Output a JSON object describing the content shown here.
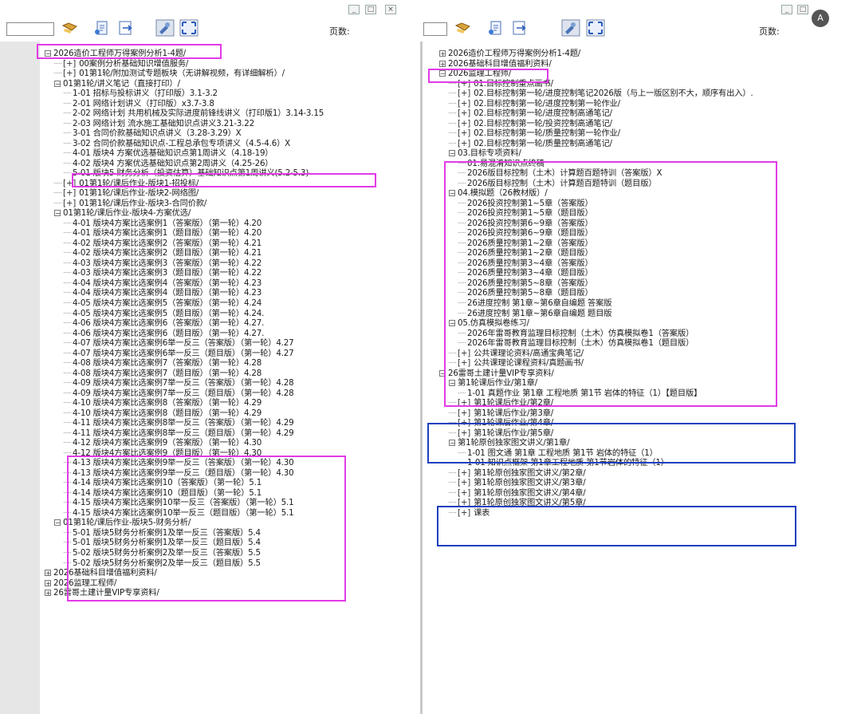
{
  "left_pane": {
    "pages_label": "页数:",
    "window_buttons": [
      "_",
      "□",
      "×"
    ],
    "rows": [
      {
        "indent": 0,
        "toggle": "⊟",
        "text": "2026造价工程师万得案例分析1-4题/"
      },
      {
        "indent": 1,
        "toggle": "",
        "prefix": "[+]",
        "text": "00案例分析基础知识增值服务/"
      },
      {
        "indent": 1,
        "toggle": "",
        "prefix": "[+]",
        "text": "01第1轮/附加测试专题板块（无讲解视频，有详细解析）/"
      },
      {
        "indent": 1,
        "toggle": "⊟",
        "text": "01第1轮/讲义笔记（直接打印）/"
      },
      {
        "indent": 2,
        "toggle": "",
        "text": "1-01 招标与投标讲义（打印版）3.1-3.2"
      },
      {
        "indent": 2,
        "toggle": "",
        "text": "2-01 网络计划讲义（打印版）x3.7-3.8"
      },
      {
        "indent": 2,
        "toggle": "",
        "text": "2-02 网络计划 共用机械及实际进度前锋线讲义（打印版1）3.14-3.15"
      },
      {
        "indent": 2,
        "toggle": "",
        "text": "2-03 网络计划 流水施工基础知识点讲义3.21-3.22"
      },
      {
        "indent": 2,
        "toggle": "",
        "text": "3-01 合同价款基础知识点讲义（3.28-3.29）X"
      },
      {
        "indent": 2,
        "toggle": "",
        "text": "3-02 合同价款基础知识点-工程总承包专项讲义（4.5-4.6）X"
      },
      {
        "indent": 2,
        "toggle": "",
        "text": "4-01 版块4 方案优选基础知识点第1周讲义（4.18-19）"
      },
      {
        "indent": 2,
        "toggle": "",
        "text": "4-02 版块4 方案优选基础知识点第2周讲义（4.25-26）"
      },
      {
        "indent": 2,
        "toggle": "",
        "text": "5-01 版块5 财务分析（投资估算）基础知识点第1周讲义(5.2-5.3)"
      },
      {
        "indent": 1,
        "toggle": "",
        "prefix": "[+]",
        "text": "01第1轮/课后作业-版块1-招投标/"
      },
      {
        "indent": 1,
        "toggle": "",
        "prefix": "[+]",
        "text": "01第1轮/课后作业-版块2-网络图/"
      },
      {
        "indent": 1,
        "toggle": "",
        "prefix": "[+]",
        "text": "01第1轮/课后作业-版块3-合同价款/"
      },
      {
        "indent": 1,
        "toggle": "⊟",
        "text": "01第1轮/课后作业-版块4-方案优选/"
      },
      {
        "indent": 2,
        "toggle": "",
        "text": "4-01 版块4方案比选案例1（答案版）（第一轮）4.20"
      },
      {
        "indent": 2,
        "toggle": "",
        "text": "4-01 版块4方案比选案例1（题目版）（第一轮）4.20"
      },
      {
        "indent": 2,
        "toggle": "",
        "text": "4-02 版块4方案比选案例2（答案版）（第一轮）4.21"
      },
      {
        "indent": 2,
        "toggle": "",
        "text": "4-02 版块4方案比选案例2（题目版）（第一轮）4.21"
      },
      {
        "indent": 2,
        "toggle": "",
        "text": "4-03 版块4方案比选案例3（答案版）（第一轮）4.22"
      },
      {
        "indent": 2,
        "toggle": "",
        "text": "4-03 版块4方案比选案例3（题目版）（第一轮）4.22"
      },
      {
        "indent": 2,
        "toggle": "",
        "text": "4-04 版块4方案比选案例4（答案版）（第一轮）4.23"
      },
      {
        "indent": 2,
        "toggle": "",
        "text": "4-04 版块4方案比选案例4（题目版）（第一轮）4.23"
      },
      {
        "indent": 2,
        "toggle": "",
        "text": "4-05 版块4方案比选案例5（答案版）（第一轮）4.24"
      },
      {
        "indent": 2,
        "toggle": "",
        "text": "4-05 版块4方案比选案例5（题目版）（第一轮）4.24."
      },
      {
        "indent": 2,
        "toggle": "",
        "text": "4-06 版块4方案比选案例6（答案版）（第一轮）4.27."
      },
      {
        "indent": 2,
        "toggle": "",
        "text": "4-06 版块4方案比选案例6（题目版）（第一轮）4.27."
      },
      {
        "indent": 2,
        "toggle": "",
        "text": "4-07 版块4方案比选案例6举一反三（答案版）（第一轮）4.27"
      },
      {
        "indent": 2,
        "toggle": "",
        "text": "4-07 版块4方案比选案例6举一反三（题目版）（第一轮）4.27"
      },
      {
        "indent": 2,
        "toggle": "",
        "text": "4-08 版块4方案比选案例7（答案版）（第一轮）4.28"
      },
      {
        "indent": 2,
        "toggle": "",
        "text": "4-08 版块4方案比选案例7（题目版）（第一轮）4.28"
      },
      {
        "indent": 2,
        "toggle": "",
        "text": "4-09 版块4方案比选案例7举一反三（答案版）（第一轮）4.28"
      },
      {
        "indent": 2,
        "toggle": "",
        "text": "4-09 版块4方案比选案例7举一反三（题目版）（第一轮）4.28"
      },
      {
        "indent": 2,
        "toggle": "",
        "text": "4-10 版块4方案比选案例8（答案版）（第一轮）4.29"
      },
      {
        "indent": 2,
        "toggle": "",
        "text": "4-10 版块4方案比选案例8（题目版）（第一轮）4.29"
      },
      {
        "indent": 2,
        "toggle": "",
        "text": "4-11 版块4方案比选案例8举一反三（答案版）（第一轮）4.29"
      },
      {
        "indent": 2,
        "toggle": "",
        "text": "4-11 版块4方案比选案例8举一反三（题目版）（第一轮）4.29"
      },
      {
        "indent": 2,
        "toggle": "",
        "text": "4-12 版块4方案比选案例9（答案版）（第一轮）4.30"
      },
      {
        "indent": 2,
        "toggle": "",
        "text": "4-12 版块4方案比选案例9（题目版）（第一轮）4.30"
      },
      {
        "indent": 2,
        "toggle": "",
        "text": "4-13 版块4方案比选案例9举一反三（答案版）（第一轮）4.30"
      },
      {
        "indent": 2,
        "toggle": "",
        "text": "4-13 版块4方案比选案例9举一反三（题目版）（第一轮）4.30"
      },
      {
        "indent": 2,
        "toggle": "",
        "text": "4-14 版块4方案比选案例10（答案版）（第一轮）5.1"
      },
      {
        "indent": 2,
        "toggle": "",
        "text": "4-14 版块4方案比选案例10（题目版）（第一轮）5.1"
      },
      {
        "indent": 2,
        "toggle": "",
        "text": "4-15 版块4方案比选案例10举一反三（答案版）（第一轮）5.1"
      },
      {
        "indent": 2,
        "toggle": "",
        "text": "4-15 版块4方案比选案例10举一反三（题目版）（第一轮）5.1"
      },
      {
        "indent": 1,
        "toggle": "⊟",
        "text": "01第1轮/课后作业-版块5-财务分析/"
      },
      {
        "indent": 2,
        "toggle": "",
        "text": "5-01 版块5财务分析案例1及举一反三（答案版）5.4"
      },
      {
        "indent": 2,
        "toggle": "",
        "text": "5-01 版块5财务分析案例1及举一反三（题目版）5.4"
      },
      {
        "indent": 2,
        "toggle": "",
        "text": "5-02 版块5财务分析案例2及举一反三（答案版）5.5"
      },
      {
        "indent": 2,
        "toggle": "",
        "text": "5-02 版块5财务分析案例2及举一反三（题目版）5.5"
      },
      {
        "indent": 0,
        "toggle": "⊞",
        "text": "2026基础科目增值福利资料/"
      },
      {
        "indent": 0,
        "toggle": "⊞",
        "text": "2026监理工程师/"
      },
      {
        "indent": 0,
        "toggle": "⊞",
        "text": "26雷哥土建计量VIP专享资料/"
      }
    ]
  },
  "right_pane": {
    "pages_label": "页数:",
    "window_buttons": [
      "_",
      "□"
    ],
    "avatar_letter": "A",
    "rows": [
      {
        "indent": 0,
        "toggle": "⊞",
        "text": "2026造价工程师万得案例分析1-4题/"
      },
      {
        "indent": 0,
        "toggle": "⊞",
        "text": "2026基础科目增值福利资料/"
      },
      {
        "indent": 0,
        "toggle": "⊟",
        "text": "2026监理工程师/"
      },
      {
        "indent": 1,
        "toggle": "",
        "prefix": "[+]",
        "text": "01.目标控制重点画书/"
      },
      {
        "indent": 1,
        "toggle": "",
        "prefix": "[+]",
        "text": "02.目标控制第一轮/进度控制笔记2026版（与上一版区别不大，顺序有出入）."
      },
      {
        "indent": 1,
        "toggle": "",
        "prefix": "[+]",
        "text": "02.目标控制第一轮/进度控制第一轮作业/"
      },
      {
        "indent": 1,
        "toggle": "",
        "prefix": "[+]",
        "text": "02.目标控制第一轮/进度控制高通笔记/"
      },
      {
        "indent": 1,
        "toggle": "",
        "prefix": "[+]",
        "text": "02.目标控制第一轮/投资控制高通笔记/"
      },
      {
        "indent": 1,
        "toggle": "",
        "prefix": "[+]",
        "text": "02.目标控制第一轮/质量控制第一轮作业/"
      },
      {
        "indent": 1,
        "toggle": "",
        "prefix": "[+]",
        "text": "02.目标控制第一轮/质量控制高通笔记/"
      },
      {
        "indent": 1,
        "toggle": "⊟",
        "text": "03.目标专项资料/"
      },
      {
        "indent": 2,
        "toggle": "",
        "text": "01.易混淆知识点终稿"
      },
      {
        "indent": 2,
        "toggle": "",
        "text": "2026版目标控制（土木）计算题百题特训（答案版）X"
      },
      {
        "indent": 2,
        "toggle": "",
        "text": "2026版目标控制（土木）计算题百题特训（题目版）"
      },
      {
        "indent": 1,
        "toggle": "⊟",
        "text": "04.模拟题（26教材版）/"
      },
      {
        "indent": 2,
        "toggle": "",
        "text": "2026投资控制第1~5章（答案版）"
      },
      {
        "indent": 2,
        "toggle": "",
        "text": "2026投资控制第1~5章（题目版）"
      },
      {
        "indent": 2,
        "toggle": "",
        "text": "2026投资控制第6~9章（答案版）"
      },
      {
        "indent": 2,
        "toggle": "",
        "text": "2026投资控制第6~9章（题目版）"
      },
      {
        "indent": 2,
        "toggle": "",
        "text": "2026质量控制第1~2章（答案版）"
      },
      {
        "indent": 2,
        "toggle": "",
        "text": "2026质量控制第1~2章（题目版）"
      },
      {
        "indent": 2,
        "toggle": "",
        "text": "2026质量控制第3~4章（答案版）"
      },
      {
        "indent": 2,
        "toggle": "",
        "text": "2026质量控制第3~4章（题目版）"
      },
      {
        "indent": 2,
        "toggle": "",
        "text": "2026质量控制第5~8章（答案版）"
      },
      {
        "indent": 2,
        "toggle": "",
        "text": "2026质量控制第5~8章（题目版）"
      },
      {
        "indent": 2,
        "toggle": "",
        "text": "26进度控制 第1章~第6章自编题 答案版"
      },
      {
        "indent": 2,
        "toggle": "",
        "text": "26进度控制 第1章~第6章自编题 题目版"
      },
      {
        "indent": 1,
        "toggle": "⊟",
        "text": "05.仿真模拟卷练习/"
      },
      {
        "indent": 2,
        "toggle": "",
        "text": "2026年雷哥教育监理目标控制（土木）仿真模拟卷1（答案版）"
      },
      {
        "indent": 2,
        "toggle": "",
        "text": "2026年雷哥教育监理目标控制（土木）仿真模拟卷1（题目版）"
      },
      {
        "indent": 1,
        "toggle": "",
        "prefix": "[+]",
        "text": "公共课理论资料/高通宝典笔记/"
      },
      {
        "indent": 1,
        "toggle": "",
        "prefix": "[+]",
        "text": "公共课理论课程资料/真题画书/"
      },
      {
        "indent": 0,
        "toggle": "⊟",
        "text": "26雷哥土建计量VIP专享资料/"
      },
      {
        "indent": 1,
        "toggle": "⊟",
        "text": "第1轮课后作业/第1章/"
      },
      {
        "indent": 2,
        "toggle": "",
        "text": "1-01 真题作业 第1章 工程地质 第1节 岩体的特征（1）【题目版】"
      },
      {
        "indent": 1,
        "toggle": "",
        "prefix": "[+]",
        "text": "第1轮课后作业/第2章/"
      },
      {
        "indent": 1,
        "toggle": "",
        "prefix": "[+]",
        "text": "第1轮课后作业/第3章/"
      },
      {
        "indent": 1,
        "toggle": "",
        "prefix": "[+]",
        "text": "第1轮课后作业/第4章/"
      },
      {
        "indent": 1,
        "toggle": "",
        "prefix": "[+]",
        "text": "第1轮课后作业/第5章/"
      },
      {
        "indent": 1,
        "toggle": "⊟",
        "text": "第1轮原创独家图文讲义/第1章/"
      },
      {
        "indent": 2,
        "toggle": "",
        "text": "1-01 图文通 第1章 工程地质 第1节 岩体的特征（1）"
      },
      {
        "indent": 2,
        "toggle": "",
        "text": "1-01 知识点框架 第1章工程地质 第1节岩体的特征（1）"
      },
      {
        "indent": 1,
        "toggle": "",
        "prefix": "[+]",
        "text": "第1轮原创独家图文讲义/第2章/"
      },
      {
        "indent": 1,
        "toggle": "",
        "prefix": "[+]",
        "text": "第1轮原创独家图文讲义/第3章/"
      },
      {
        "indent": 1,
        "toggle": "",
        "prefix": "[+]",
        "text": "第1轮原创独家图文讲义/第4章/"
      },
      {
        "indent": 1,
        "toggle": "",
        "prefix": "[+]",
        "text": "第1轮原创独家图文讲义/第5章/"
      },
      {
        "indent": 1,
        "toggle": "",
        "prefix": "[+]",
        "text": "课表"
      }
    ]
  },
  "colors": {
    "highlight_magenta": "#e23ae6",
    "highlight_blue": "#1f3fbf",
    "gutter": "#e6e6e6"
  }
}
